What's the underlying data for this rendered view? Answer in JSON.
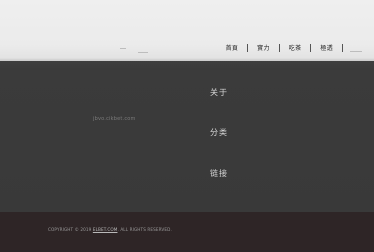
{
  "nav": {
    "items": [
      "首頁",
      "實力",
      "吃茶",
      "極透"
    ]
  },
  "main": {
    "domain_text": "jbvo.cikbet.com",
    "sections": [
      "关于",
      "分类",
      "链接"
    ]
  },
  "footer": {
    "copyright_prefix": "COPYRIGHT © 2019",
    "copyright_link": "ELBET.COM",
    "copyright_suffix": ". ALL RIGHTS RESERVED."
  }
}
